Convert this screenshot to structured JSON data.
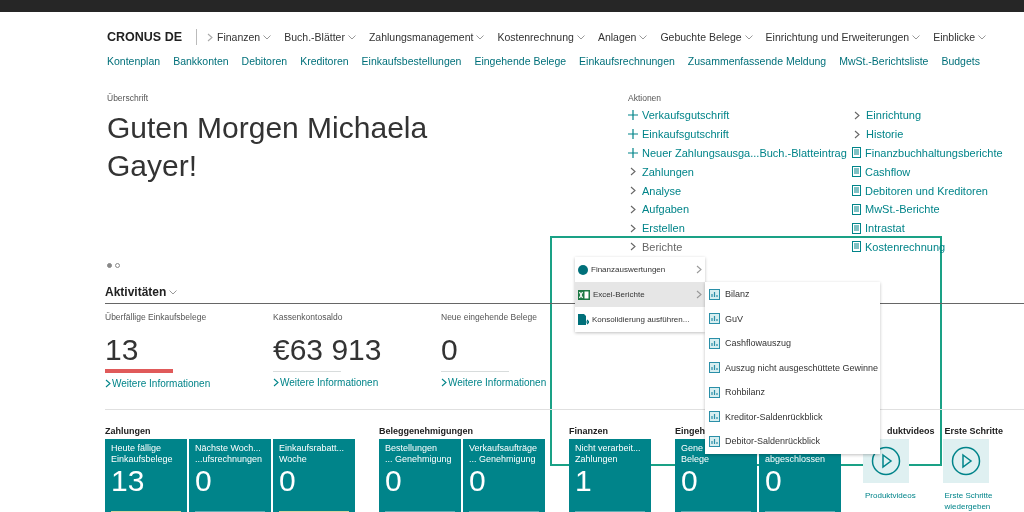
{
  "nav": {
    "company": "CRONUS DE",
    "menus": [
      "Finanzen",
      "Buch.-Blätter",
      "Zahlungsmanagement",
      "Kostenrechnung",
      "Anlagen",
      "Gebuchte Belege",
      "Einrichtung und Erweiterungen",
      "Einblicke"
    ],
    "links": [
      "Kontenplan",
      "Bankkonten",
      "Debitoren",
      "Kreditoren",
      "Einkaufsbestellungen",
      "Eingehende Belege",
      "Einkaufsrechnungen",
      "Zusammenfassende Meldung",
      "MwSt.-Berichtsliste",
      "Budgets"
    ]
  },
  "headline": {
    "caption": "Überschrift",
    "greeting": "Guten Morgen Michaela Gayer!",
    "dots": [
      {
        "selected": true
      },
      {
        "selected": false
      }
    ]
  },
  "actions": {
    "caption": "Aktionen",
    "columns": [
      [
        {
          "kind": "new",
          "label": "Verkaufsgutschrift"
        },
        {
          "kind": "new",
          "label": "Einkaufsgutschrift"
        },
        {
          "kind": "new",
          "label": "Neuer Zahlungsausga...Buch.-Blatteintrag"
        },
        {
          "kind": "group",
          "label": "Zahlungen"
        },
        {
          "kind": "group",
          "label": "Analyse"
        },
        {
          "kind": "group",
          "label": "Aufgaben"
        },
        {
          "kind": "group",
          "label": "Erstellen"
        },
        {
          "kind": "group",
          "label": "Berichte",
          "expanded": true
        }
      ],
      [
        {
          "kind": "group",
          "label": "Einrichtung"
        },
        {
          "kind": "group",
          "label": "Historie"
        },
        {
          "kind": "report",
          "label": "Finanzbuchhaltungsberichte"
        },
        {
          "kind": "report",
          "label": "Cashflow"
        },
        {
          "kind": "report",
          "label": "Debitoren und Kreditoren"
        },
        {
          "kind": "report",
          "label": "MwSt.-Berichte"
        },
        {
          "kind": "report",
          "label": "Intrastat"
        },
        {
          "kind": "report",
          "label": "Kostenrechnung"
        }
      ]
    ]
  },
  "activities": {
    "title": "Aktivitäten",
    "cues": [
      {
        "label": "Überfällige Einkaufsbelege",
        "value": "13",
        "color": "#e05a5a",
        "link": "Weitere Informationen"
      },
      {
        "label": "Kassenkontosaldo",
        "value": "€63 913",
        "color": "#d8dcdc",
        "link": "Weitere Informationen"
      },
      {
        "label": "Neue eingehende Belege",
        "value": "0",
        "color": "#d8dcdc",
        "link": "Weitere Informationen"
      }
    ]
  },
  "tile_groups": [
    {
      "title": "Zahlungen",
      "tiles": [
        {
          "lines": [
            "Heute fällige",
            "Einkaufsbelege"
          ],
          "value": "13",
          "color": "#d8d3a0"
        },
        {
          "lines": [
            "Nächste Woch...",
            "...ufsrechnungen"
          ],
          "value": "0",
          "color": "#5fb0b5"
        },
        {
          "lines": [
            "Einkaufsrabatt...",
            "Woche"
          ],
          "value": "0",
          "color": "#d8d3a0"
        }
      ]
    },
    {
      "title": "Beleggenehmigungen",
      "tiles": [
        {
          "lines": [
            "Bestellungen",
            "... Genehmigung"
          ],
          "value": "0",
          "color": "#5fb0b5"
        },
        {
          "lines": [
            "Verkaufsaufträge",
            "... Genehmigung"
          ],
          "value": "0",
          "color": "#5fb0b5"
        }
      ]
    },
    {
      "title": "Finanzen",
      "tiles": [
        {
          "lines": [
            "Nicht verarbeit...",
            "Zahlungen"
          ],
          "value": "1",
          "color": "#5fb0b5"
        }
      ]
    },
    {
      "title": "Eingeh",
      "tiles": [
        {
          "lines": [
            "Gene",
            "Belege"
          ],
          "value": "0",
          "color": "#5fb0b5"
        },
        {
          "lines": [
            "abgeschlossen"
          ],
          "value": "0",
          "color": "#5fb0b5"
        }
      ]
    }
  ],
  "video_groups": [
    {
      "title": "duktvideos",
      "label": "Produktvideos"
    },
    {
      "title": "Erste Schritte",
      "label": "Erste Schritte wiedergeben"
    }
  ],
  "reports_menu": {
    "items": [
      {
        "kind": "circle",
        "label": "Finanzauswertungen",
        "submenu": true,
        "selected": false
      },
      {
        "kind": "excel",
        "label": "Excel-Berichte",
        "submenu": true,
        "selected": true
      },
      {
        "kind": "run",
        "label": "Konsolidierung ausführen...",
        "submenu": false,
        "selected": false
      }
    ],
    "submenu": [
      "Bilanz",
      "GuV",
      "Cashflowauszug",
      "Auszug nicht ausgeschüttete Gewinne",
      "Rohbilanz",
      "Kreditor-Saldenrückblick",
      "Debitor-Saldenrückblick"
    ]
  }
}
